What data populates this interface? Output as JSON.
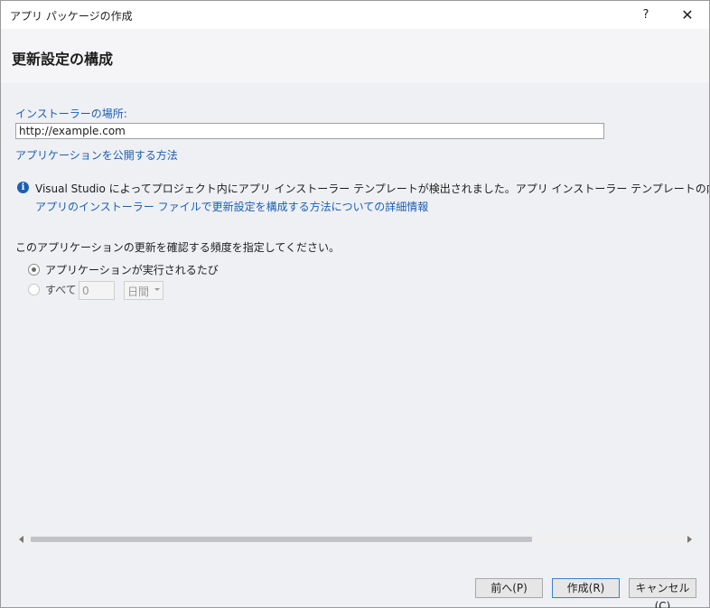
{
  "window": {
    "title": "アプリ パッケージの作成",
    "help_label": "?",
    "close_label": "✕"
  },
  "header": {
    "title": "更新設定の構成"
  },
  "installer": {
    "label": "インストーラーの場所:",
    "url_value": "http://example.com",
    "publish_link": "アプリケーションを公開する方法"
  },
  "info": {
    "icon_glyph": "i",
    "message": "Visual Studio によってプロジェクト内にアプリ インストーラー テンプレートが検出されました。アプリ インストーラー テンプレートの内容は Visual Studio では変更でき",
    "link": "アプリのインストーラー ファイルで更新設定を構成する方法についての詳細情報"
  },
  "frequency": {
    "label": "このアプリケーションの更新を確認する頻度を指定してください。",
    "option_each_run": "アプリケーションが実行されるたび",
    "option_every": "すべて",
    "interval_value": "0",
    "unit_selected": "日間"
  },
  "footer": {
    "back_label": "前へ(P)",
    "create_label": "作成(R)",
    "cancel_label": "キャンセル(C)"
  },
  "colors": {
    "link_blue": "#1a5fb4",
    "background": "#eff0f4",
    "primary_button_border": "#3c7fd1"
  },
  "icons": [
    "help-icon",
    "close-icon",
    "info-icon",
    "chevron-down-icon",
    "arrow-left-icon",
    "arrow-right-icon"
  ]
}
